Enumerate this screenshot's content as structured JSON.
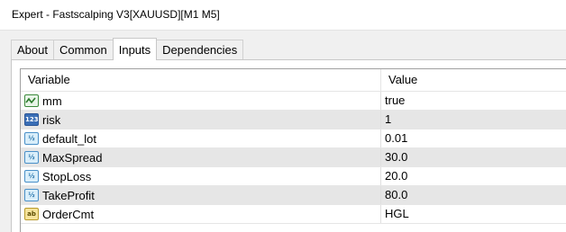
{
  "window": {
    "title": "Expert - Fastscalping V3[XAUUSD][M1 M5]"
  },
  "tabs": [
    {
      "label": "About",
      "active": false
    },
    {
      "label": "Common",
      "active": false
    },
    {
      "label": "Inputs",
      "active": true
    },
    {
      "label": "Dependencies",
      "active": false
    }
  ],
  "table": {
    "headers": {
      "variable": "Variable",
      "value": "Value"
    },
    "rows": [
      {
        "name": "mm",
        "value": "true",
        "type_icon": "bool-icon"
      },
      {
        "name": "risk",
        "value": "1",
        "type_icon": "int-icon",
        "icon_text": "123"
      },
      {
        "name": "default_lot",
        "value": "0.01",
        "type_icon": "double-icon",
        "icon_text": "½"
      },
      {
        "name": "MaxSpread",
        "value": "30.0",
        "type_icon": "double-icon",
        "icon_text": "½"
      },
      {
        "name": "StopLoss",
        "value": "20.0",
        "type_icon": "double-icon",
        "icon_text": "½"
      },
      {
        "name": "TakeProfit",
        "value": "80.0",
        "type_icon": "double-icon",
        "icon_text": "½"
      },
      {
        "name": "OrderCmt",
        "value": "HGL",
        "type_icon": "string-icon",
        "icon_text": "ab"
      }
    ]
  }
}
